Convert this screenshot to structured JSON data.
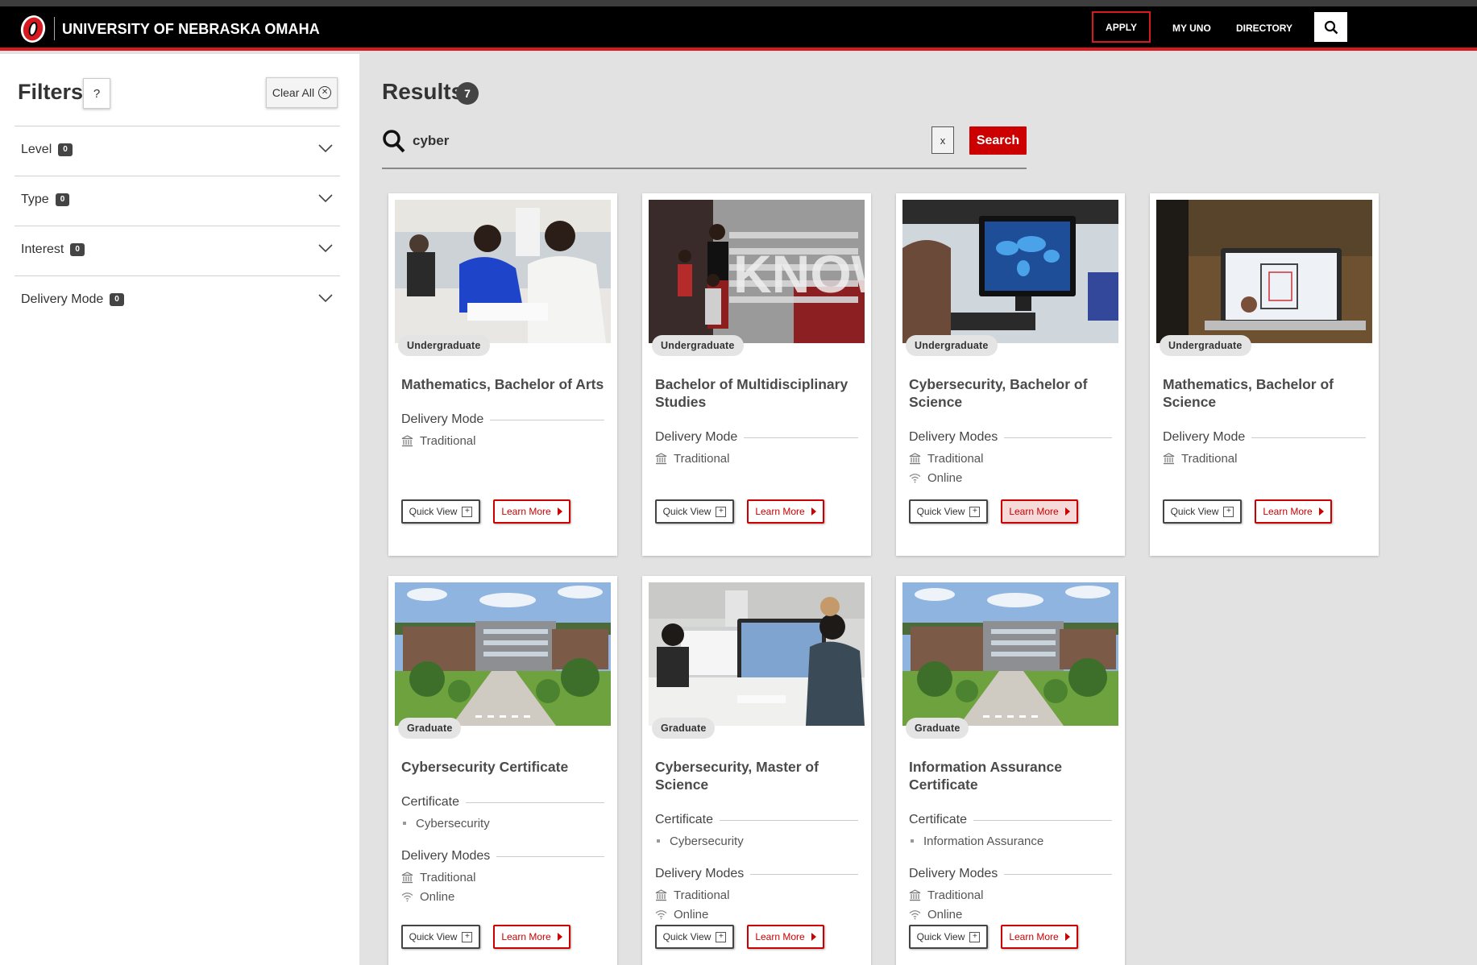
{
  "header": {
    "university_name": "UNIVERSITY OF NEBRASKA OMAHA",
    "nav": {
      "apply": "APPLY",
      "my_uno": "MY UNO",
      "directory": "DIRECTORY"
    }
  },
  "filters": {
    "title": "Filters",
    "help_label": "?",
    "clear_all_label": "Clear All",
    "groups": [
      {
        "label": "Level",
        "count": "0"
      },
      {
        "label": "Type",
        "count": "0"
      },
      {
        "label": "Interest",
        "count": "0"
      },
      {
        "label": "Delivery Mode",
        "count": "0"
      }
    ]
  },
  "results": {
    "title": "Results",
    "count": "7",
    "search": {
      "value": "cyber",
      "clear_label": "x",
      "button_label": "Search"
    }
  },
  "cards": [
    {
      "level": "Undergraduate",
      "title": "Mathematics, Bachelor of Arts",
      "delivery_heading": "Delivery Mode",
      "delivery": [
        "Traditional"
      ]
    },
    {
      "level": "Undergraduate",
      "title": "Bachelor of Multidisciplinary Studies",
      "delivery_heading": "Delivery Mode",
      "delivery": [
        "Traditional"
      ]
    },
    {
      "level": "Undergraduate",
      "title": "Cybersecurity, Bachelor of Science",
      "delivery_heading": "Delivery Modes",
      "delivery": [
        "Traditional",
        "Online"
      ]
    },
    {
      "level": "Undergraduate",
      "title": "Mathematics, Bachelor of Science",
      "delivery_heading": "Delivery Mode",
      "delivery": [
        "Traditional"
      ]
    },
    {
      "level": "Graduate",
      "title": "Cybersecurity Certificate",
      "cert_heading": "Certificate",
      "cert_item": "Cybersecurity",
      "delivery_heading": "Delivery Modes",
      "delivery": [
        "Traditional",
        "Online"
      ]
    },
    {
      "level": "Graduate",
      "title": "Cybersecurity, Master of Science",
      "cert_heading": "Certificate",
      "cert_item": "Cybersecurity",
      "delivery_heading": "Delivery Modes",
      "delivery": [
        "Traditional",
        "Online"
      ]
    },
    {
      "level": "Graduate",
      "title": "Information Assurance Certificate",
      "cert_heading": "Certificate",
      "cert_item": "Information Assurance",
      "delivery_heading": "Delivery Modes",
      "delivery": [
        "Traditional",
        "Online"
      ]
    }
  ],
  "buttons": {
    "quick_view": "Quick View",
    "learn_more": "Learn More"
  },
  "colors": {
    "brand_red": "#d71920",
    "header_bg": "#000000",
    "badge_bg": "#444444"
  }
}
